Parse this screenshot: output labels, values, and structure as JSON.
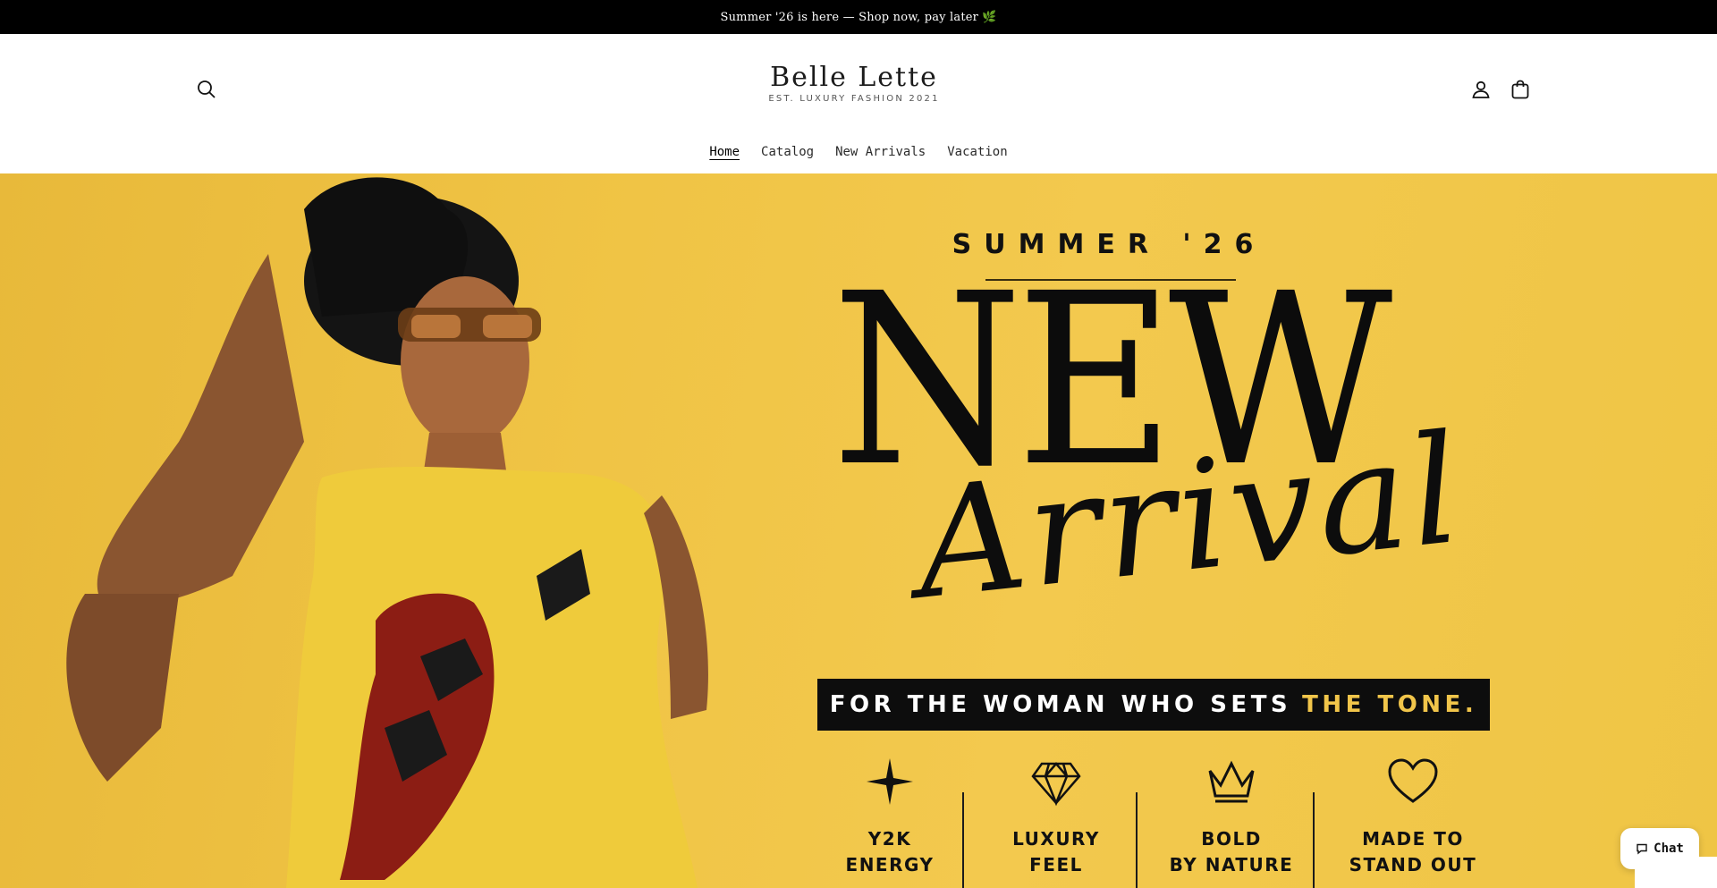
{
  "announcement": {
    "text": "Summer '26 is here — Shop now, pay later",
    "emoji": "🌿"
  },
  "header": {
    "logo_name": "Belle Lette",
    "logo_tagline": "EST. LUXURY FASHION 2021",
    "icons": {
      "search": "search-icon",
      "account": "account-icon",
      "cart": "cart-icon"
    }
  },
  "nav": {
    "items": [
      {
        "label": "Home",
        "active": true
      },
      {
        "label": "Catalog",
        "active": false
      },
      {
        "label": "New Arrivals",
        "active": false
      },
      {
        "label": "Vacation",
        "active": false
      }
    ]
  },
  "hero": {
    "season": "SUMMER '26",
    "headline": "NEW",
    "script": "Arrival",
    "tagline_main": "FOR THE WOMAN WHO SETS",
    "tagline_highlight": "THE TONE.",
    "features": [
      {
        "line1": "Y2K",
        "line2": "ENERGY",
        "icon": "sparkle-icon"
      },
      {
        "line1": "LUXURY",
        "line2": "FEEL",
        "icon": "diamond-icon"
      },
      {
        "line1": "BOLD",
        "line2": "BY NATURE",
        "icon": "crown-icon"
      },
      {
        "line1": "MADE TO",
        "line2": "STAND OUT",
        "icon": "heart-icon"
      }
    ],
    "colors": {
      "background": "#f0c445",
      "text": "#0c0c0c",
      "highlight": "#f1c54a"
    }
  },
  "chat": {
    "label": "Chat",
    "icon": "chat-bubble-icon"
  }
}
